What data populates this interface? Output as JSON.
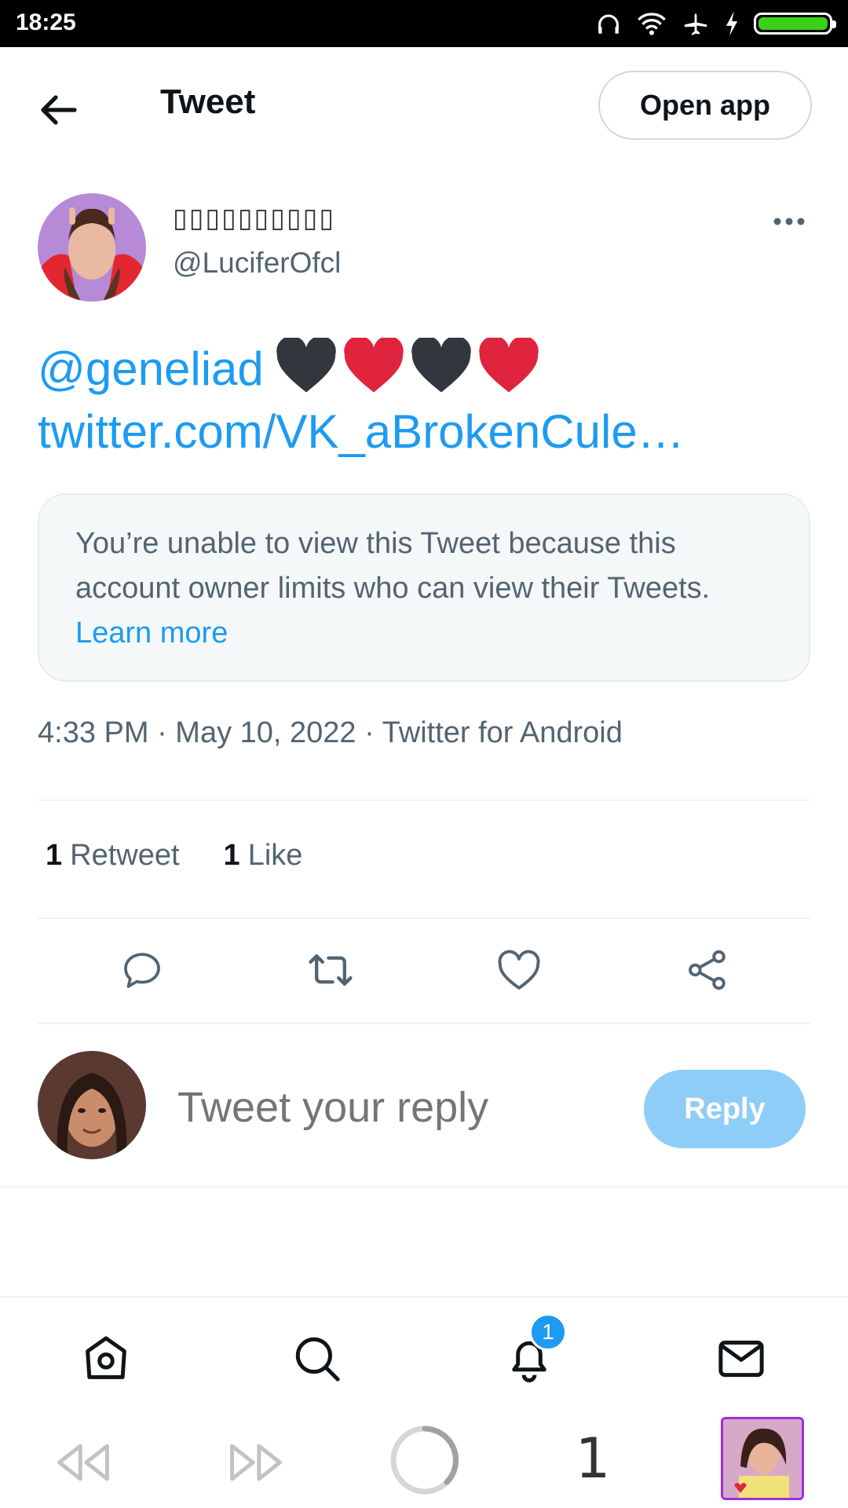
{
  "status_bar": {
    "time": "18:25",
    "icons": [
      "headphones-icon",
      "wifi-icon",
      "airplane-icon",
      "charging-icon",
      "battery-icon"
    ],
    "battery_color": "#3ad11a"
  },
  "header": {
    "title": "Tweet",
    "open_app_label": "Open app"
  },
  "tweet": {
    "display_name": "▯▯▯▯▯▯▯▯▯▯",
    "handle": "@LuciferOfcl",
    "mention": "@geneliad",
    "hearts": [
      "black-heart",
      "red-heart",
      "black-heart",
      "red-heart"
    ],
    "link": "twitter.com/VK_aBrokenCule…",
    "notice_text": "You’re unable to view this Tweet because this account owner limits who can view their Tweets.",
    "notice_link": "Learn more",
    "meta": "4:33 PM · May 10, 2022 · Twitter for Android",
    "retweet_count": "1",
    "retweet_label": "Retweet",
    "like_count": "1",
    "like_label": "Like"
  },
  "actions": [
    "reply-icon",
    "retweet-icon",
    "like-icon",
    "share-icon"
  ],
  "reply_bar": {
    "placeholder": "Tweet your reply",
    "button_label": "Reply"
  },
  "bottom_nav": {
    "items": [
      "home-icon",
      "search-icon",
      "notifications-icon",
      "messages-icon"
    ],
    "notification_badge": "1"
  },
  "system_nav": {
    "tab_count": "1"
  },
  "colors": {
    "accent": "#1d9bf0",
    "reply_button": "#8ecdf8",
    "heart_red": "#e0243e",
    "heart_black": "#31373d"
  }
}
